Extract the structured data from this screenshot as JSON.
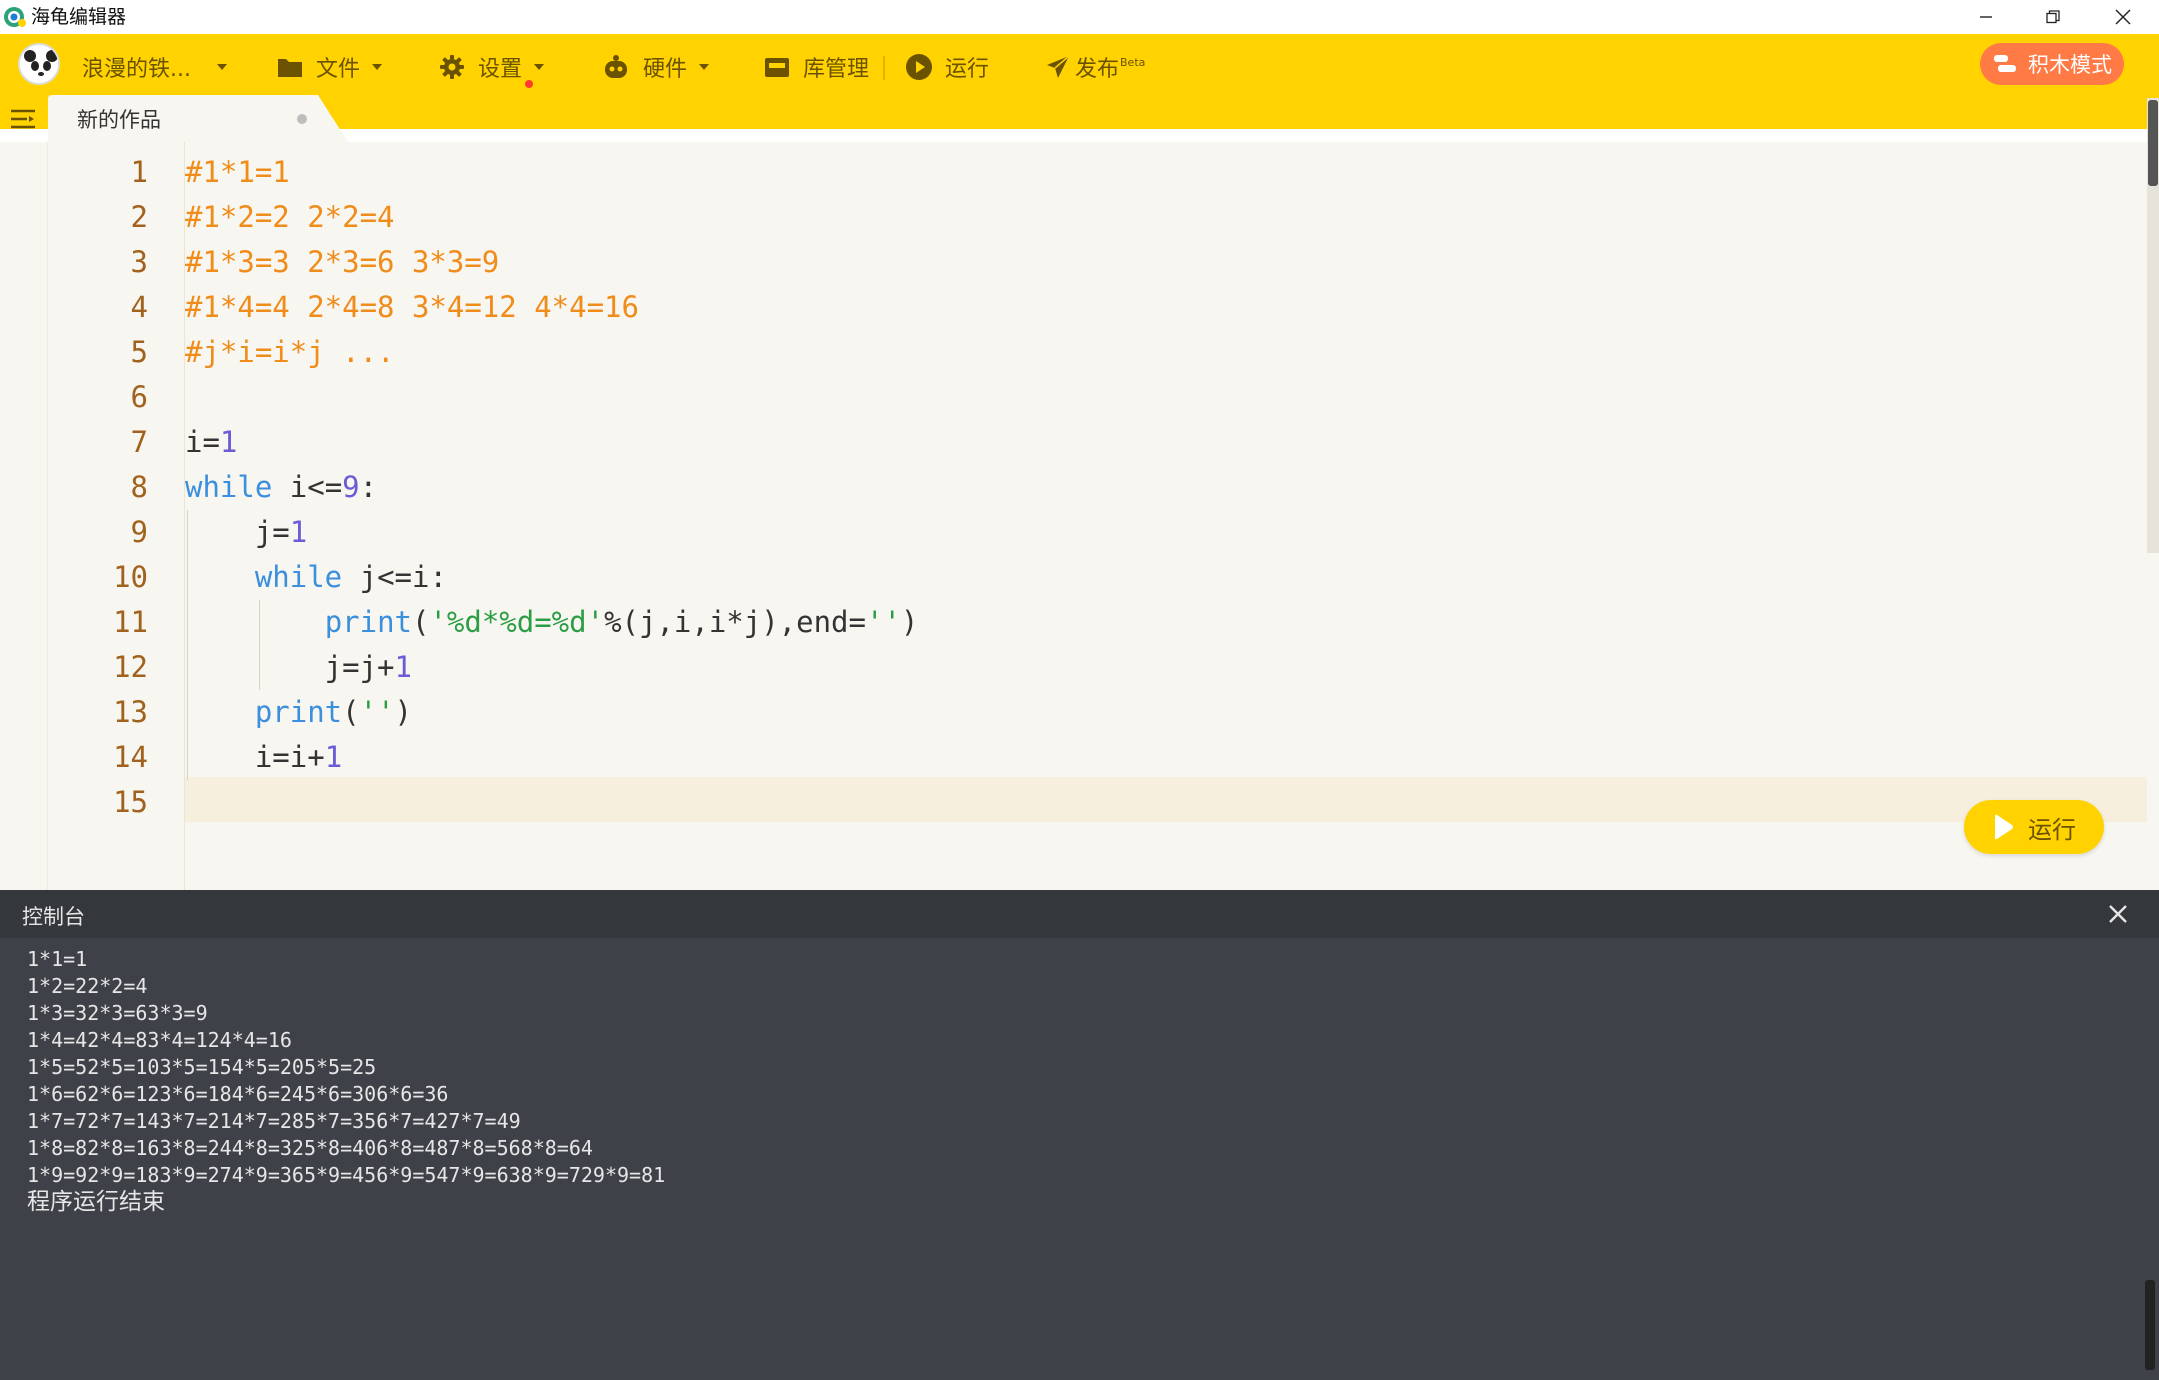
{
  "window": {
    "title": "海龟编辑器",
    "controls": [
      "minimize",
      "restore",
      "close"
    ]
  },
  "toolbar": {
    "user_name": "浪漫的铁...",
    "file_label": "文件",
    "settings_label": "设置",
    "hardware_label": "硬件",
    "library_label": "库管理",
    "run_label": "运行",
    "publish_label": "发布",
    "publish_badge": "Beta",
    "blocks_mode_label": "积木模式",
    "accent_color": "#ffd200",
    "blocks_button_color": "#ff7a45"
  },
  "tab": {
    "name": "新的作品"
  },
  "editor": {
    "line_numbers": [
      "1",
      "2",
      "3",
      "4",
      "5",
      "6",
      "7",
      "8",
      "9",
      "10",
      "11",
      "12",
      "13",
      "14",
      "15"
    ],
    "lines": [
      "#1*1=1",
      "#1*2=2 2*2=4",
      "#1*3=3 2*3=6 3*3=9",
      "#1*4=4 2*4=8 3*4=12 4*4=16",
      "#j*i=i*j ...",
      "",
      "i=1",
      "while i<=9:",
      "    j=1",
      "    while j<=i:",
      "        print('%d*%d=%d'%(j,i,i*j),end='')",
      "        j=j+1",
      "    print('')",
      "    i=i+1",
      ""
    ],
    "tokens": {
      "while": "while",
      "print": "print",
      "one": "1",
      "nine": "9",
      "fmt": "'%d*%d=%d'",
      "empty": "''"
    },
    "run_button_label": "运行"
  },
  "console": {
    "title": "控制台",
    "output": [
      "1*1=1",
      "1*2=22*2=4",
      "1*3=32*3=63*3=9",
      "1*4=42*4=83*4=124*4=16",
      "1*5=52*5=103*5=154*5=205*5=25",
      "1*6=62*6=123*6=184*6=245*6=306*6=36",
      "1*7=72*7=143*7=214*7=285*7=356*7=427*7=49",
      "1*8=82*8=163*8=244*8=325*8=406*8=487*8=568*8=64",
      "1*9=92*9=183*9=274*9=365*9=456*9=547*9=638*9=729*9=81"
    ],
    "status": "程序运行结束"
  }
}
